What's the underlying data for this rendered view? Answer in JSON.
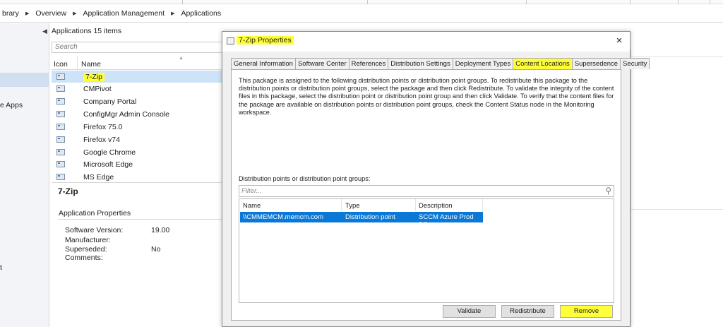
{
  "breadcrumb": [
    "brary",
    "Overview",
    "Application Management",
    "Applications"
  ],
  "leftnav": {
    "item_apps": "e Apps",
    "item_t": "t"
  },
  "apps_pane": {
    "title": "Applications 15 items",
    "search_placeholder": "Search",
    "col_icon": "Icon",
    "col_name": "Name",
    "rows": [
      "7-Zip",
      "CMPivot",
      "Company Portal",
      "ConfigMgr Admin Console",
      "Firefox 75.0",
      "Firefox v74",
      "Google Chrome",
      "Microsoft Edge",
      "MS Edge"
    ],
    "selected_row": "7-Zip"
  },
  "details": {
    "title": "7-Zip",
    "section": "Application Properties",
    "props": [
      {
        "label": "Software Version:",
        "value": "19.00"
      },
      {
        "label": "Manufacturer:",
        "value": ""
      },
      {
        "label": "Superseded:",
        "value": "No"
      },
      {
        "label": "Comments:",
        "value": ""
      }
    ]
  },
  "dialog": {
    "title": "7-Zip Properties",
    "close": "×",
    "tabs": [
      "General Information",
      "Software Center",
      "References",
      "Distribution Settings",
      "Deployment Types",
      "Content Locations",
      "Supersedence",
      "Security"
    ],
    "active_tab": "Content Locations",
    "description": "This package is assigned to the following distribution points or distribution point groups. To redistribute this package to the distribution points or distribution point groups, select the package and then click Redistribute. To validate the integrity of the content files in this package, select the distribution point or distribution point group and then click Validate. To verify that the content files for the package are available on distribution points or distribution point groups, check the Content Status node in the Monitoring workspace.",
    "dp_label": "Distribution points or distribution point groups:",
    "filter_placeholder": "Filter...",
    "columns": [
      "Name",
      "Type",
      "Description"
    ],
    "rows": [
      {
        "name": "\\\\CMMEMCM.memcm.com",
        "type": "Distribution point",
        "description": "SCCM Azure Prod DP"
      }
    ],
    "buttons": {
      "validate": "Validate",
      "redistribute": "Redistribute",
      "remove": "Remove"
    }
  },
  "colors": {
    "highlight": "#ffff3a",
    "selection": "#0a78d7",
    "list_selection": "#cde4f8"
  }
}
